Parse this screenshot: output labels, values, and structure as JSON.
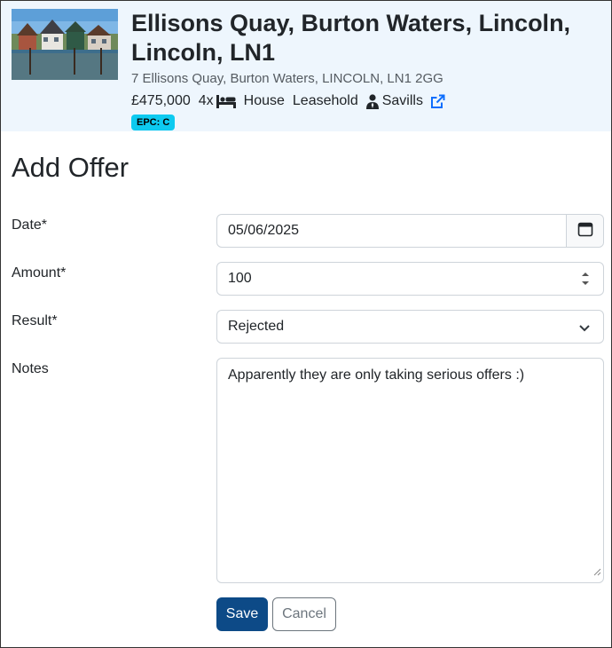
{
  "property": {
    "title": "Ellisons Quay, Burton Waters, Lincoln, Lincoln, LN1",
    "address": "7 Ellisons Quay, Burton Waters, LINCOLN, LN1 2GG",
    "price": "£475,000",
    "bedrooms": "4x",
    "type": "House",
    "tenure": "Leasehold",
    "agent": "Savills",
    "epc": "EPC: C"
  },
  "form": {
    "heading": "Add Offer",
    "date_label": "Date*",
    "date_value": "05/06/2025",
    "amount_label": "Amount*",
    "amount_value": "100",
    "result_label": "Result*",
    "result_value": "Rejected",
    "notes_label": "Notes",
    "notes_value": "Apparently they are only taking serious offers :)",
    "save_label": "Save",
    "cancel_label": "Cancel"
  },
  "icons": {
    "bed": "bed-icon",
    "agent": "user-tie-icon",
    "external": "external-link-icon",
    "calendar": "calendar-icon",
    "spinner": "spinner-arrows-icon",
    "dropdown": "chevron-down-icon"
  },
  "colors": {
    "header_bg": "#eef6fd",
    "epc_badge": "#0dcaf0",
    "primary": "#0d4a87",
    "link": "#0d6efd"
  }
}
